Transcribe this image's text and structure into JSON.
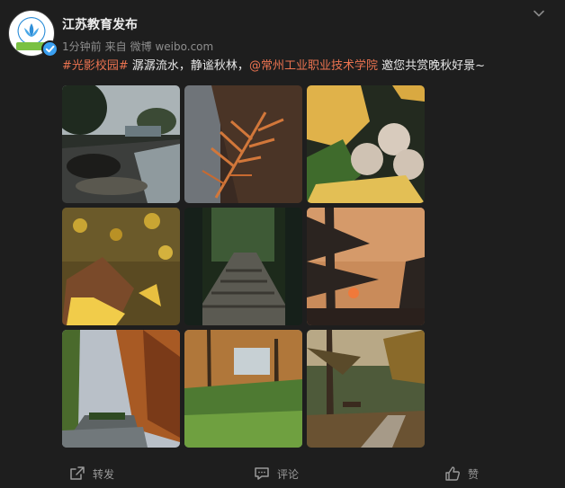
{
  "user": {
    "name": "江苏教育发布",
    "avatar_icon": "lotus-emblem-icon",
    "verified_icon": "verified-badge-icon",
    "accent": "#3aa0f2"
  },
  "meta": {
    "time": "1分钟前",
    "source_prefix": "来自",
    "source": "微博 weibo.com"
  },
  "post": {
    "hashtag": "#光影校园#",
    "text_1": " 潺潺流水，静谧秋林，",
    "mention": "@常州工业职业技术学院",
    "text_2": " 邀您共赏晚秋好景~",
    "link_color": "#eb7350"
  },
  "photos": [
    {
      "subject": "campus pond with rocks and trees"
    },
    {
      "subject": "orange larch branch close-up"
    },
    {
      "subject": "ginkgo leaves and nuts"
    },
    {
      "subject": "fallen yellow ginkgo leaves"
    },
    {
      "subject": "stone steps path through woods"
    },
    {
      "subject": "pine silhouette at sunset"
    },
    {
      "subject": "roadside metasequoia trees"
    },
    {
      "subject": "autumn trees and shrubs"
    },
    {
      "subject": "park stepping-stone path"
    }
  ],
  "actions": {
    "repost_label": "转发",
    "comment_label": "评论",
    "like_label": "赞",
    "repost_icon": "share-icon",
    "comment_icon": "comment-icon",
    "like_icon": "thumbs-up-icon"
  }
}
